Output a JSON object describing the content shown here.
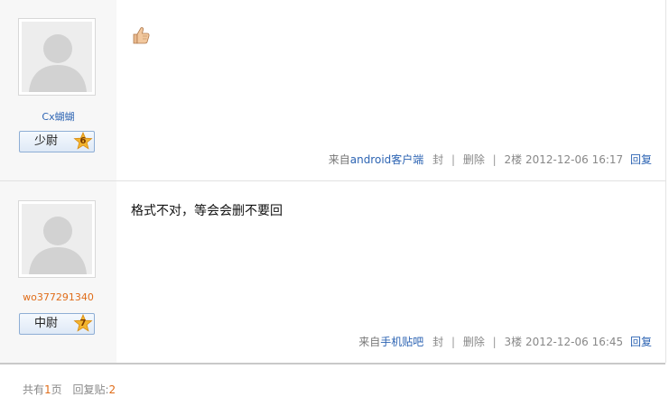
{
  "posts": [
    {
      "username": "Cx蝴蝴",
      "rank": "少尉",
      "level": "6",
      "content_icon": "thumbs-up-icon",
      "content_text": "",
      "source_prefix": "来自",
      "source_app": "android客户端",
      "ban": "封",
      "delete": "删除",
      "floor": "2楼",
      "timestamp": "2012-12-06 16:17",
      "reply": "回复"
    },
    {
      "username": "wo377291340",
      "rank": "中尉",
      "level": "7",
      "content_text": "格式不对，等会会删不要回",
      "source_prefix": "来自",
      "source_app": "手机贴吧",
      "ban": "封",
      "delete": "删除",
      "floor": "3楼",
      "timestamp": "2012-12-06 16:45",
      "reply": "回复"
    }
  ],
  "pager": {
    "total_prefix": "共有",
    "pages": "1",
    "pages_suffix": "页",
    "replies_label": "回复贴:",
    "replies": "2"
  },
  "colors": {
    "link_blue": "#2d64b3",
    "accent_orange": "#e06d1a",
    "sidebar_bg": "#f7f7f7"
  }
}
